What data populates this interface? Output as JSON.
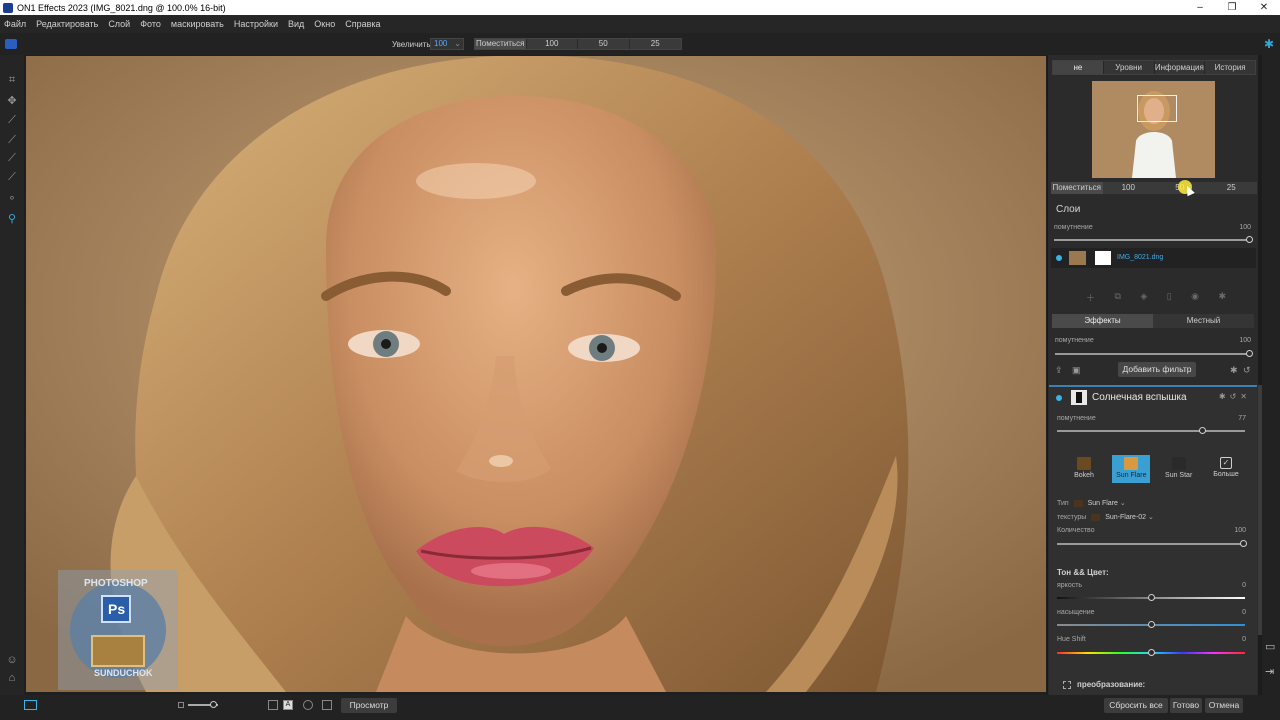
{
  "window": {
    "title": "ON1 Effects 2023 (IMG_8021.dng @ 100.0% 16-bit)",
    "controls": [
      "–",
      "❐",
      "✕"
    ]
  },
  "menu": [
    "Файл",
    "Редактировать",
    "Слой",
    "Фото",
    "маскировать",
    "Настройки",
    "Вид",
    "Окно",
    "Справка"
  ],
  "toolbar": {
    "zoom_label": "Увеличить",
    "zoom_value": "100",
    "fit_label": "Поместиться",
    "presets": [
      "100",
      "50",
      "25"
    ]
  },
  "tools": [
    "crop-icon",
    "move-icon",
    "perfect-brush-icon",
    "brush-icon",
    "refine-brush-icon",
    "retouch-brush-icon",
    "chisel-icon",
    "zoom-tool-icon",
    "hand-icon"
  ],
  "panel": {
    "tabs": [
      "не",
      "Уровни",
      "Информация",
      "История"
    ],
    "active_tab": 0,
    "nav_zoom": [
      "Поместиться",
      "100",
      "50",
      "25"
    ],
    "layers": {
      "title": "Слои",
      "opacity_label": "помутнение",
      "opacity_value": "100",
      "layer_name": "IMG_8021.dng"
    },
    "filter_tabs": [
      "Эффекты",
      "Местный"
    ],
    "active_filter_tab": 0,
    "effects_opacity_label": "помутнение",
    "effects_opacity_value": "100",
    "add_filter_label": "Добавить фильтр",
    "filter": {
      "title": "Солнечная вспышка",
      "opacity_label": "помутнение",
      "opacity_value": "77",
      "presets": [
        {
          "label": "Bokeh"
        },
        {
          "label": "Sun Flare"
        },
        {
          "label": "Sun Star"
        },
        {
          "label": "Больше"
        }
      ],
      "type_label": "Тип",
      "type_value": "Sun Flare",
      "texture_label": "текстуры",
      "texture_value": "Sun-Flare-02",
      "amount_label": "Количество",
      "amount_value": "100",
      "tone_title": "Тон && Цвет:",
      "brightness_label": "яркость",
      "brightness_value": "0",
      "saturation_label": "насыщение",
      "saturation_value": "0",
      "hue_label": "Hue Shift",
      "hue_value": "0",
      "transform_label": "преобразование:"
    }
  },
  "bottom": {
    "preview_label": "Просмотр",
    "reset_label": "Сбросить все",
    "done_label": "Готово",
    "cancel_label": "Отмена"
  },
  "watermark": {
    "top": "PHOTOSHOP",
    "bottom": "SUNDUCHOK",
    "badge": "Ps"
  },
  "colors": {
    "accent": "#3ab3e6",
    "active_preset": "#3aa0d4"
  }
}
